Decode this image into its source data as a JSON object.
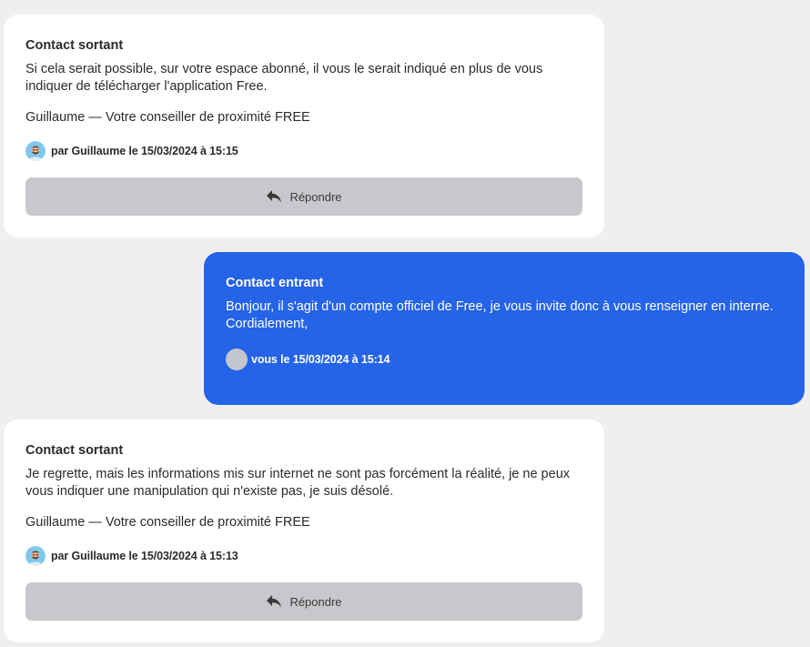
{
  "messages": [
    {
      "title": "Contact sortant",
      "body": "Si cela serait possible, sur votre espace abonné, il vous le serait indiqué en plus de vous indiquer de télécharger l'application Free.",
      "signature": "Guillaume — Votre conseiller de proximité FREE",
      "meta": "par Guillaume le 15/03/2024 à 15:15",
      "reply_label": "Répondre"
    },
    {
      "title": "Contact entrant",
      "body": "Bonjour, il s'agit d'un compte officiel de Free, je vous invite donc à vous renseigner en interne. Cordialement,",
      "meta": "vous le 15/03/2024 à 15:14"
    },
    {
      "title": "Contact sortant",
      "body": "Je regrette, mais les informations mis sur internet ne sont pas forcément la réalité, je ne peux vous indiquer une manipulation qui n'existe pas, je suis désolé.",
      "signature": "Guillaume — Votre conseiller de proximité FREE",
      "meta": "par Guillaume le 15/03/2024 à 15:13",
      "reply_label": "Répondre"
    }
  ],
  "colors": {
    "page_background": "#efefef",
    "outgoing_card": "#ffffff",
    "incoming_card": "#2563e8",
    "reply_button": "#c8c8cc"
  },
  "icons": {
    "agent_avatar": "agent-avatar-icon",
    "user_avatar": "user-avatar-icon",
    "reply": "reply-arrow-icon"
  }
}
